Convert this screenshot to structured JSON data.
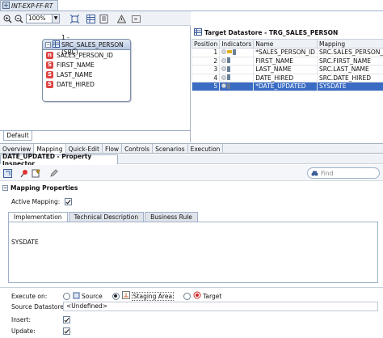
{
  "title_tab": {
    "label": "INT-EXP-FF-RT"
  },
  "diagram": {
    "zoom": "100%",
    "entity": {
      "title": "1 - SRC_SALES_PERSON (SRC)",
      "columns": [
        {
          "icon": "n",
          "name": "SALES_PERSON_ID"
        },
        {
          "icon": "S",
          "name": "FIRST_NAME"
        },
        {
          "icon": "S",
          "name": "LAST_NAME"
        },
        {
          "icon": "S",
          "name": "DATE_HIRED"
        }
      ]
    },
    "default_tab": "Default"
  },
  "target": {
    "title": "Target Datastore - TRG_SALES_PERSON",
    "headers": {
      "position": "Position",
      "indicators": "Indicators",
      "name": "Name",
      "mapping": "Mapping"
    },
    "rows": [
      {
        "position": "1",
        "name": "*SALES_PERSON_ID",
        "mapping": "SRC.SALES_PERSON_ID"
      },
      {
        "position": "2",
        "name": "FIRST_NAME",
        "mapping": "SRC.FIRST_NAME"
      },
      {
        "position": "3",
        "name": "LAST_NAME",
        "mapping": "SRC.LAST_NAME"
      },
      {
        "position": "4",
        "name": "DATE_HIRED",
        "mapping": "SRC.DATE_HIRED"
      },
      {
        "position": "5",
        "name": "*DATE_UPDATED",
        "mapping": "SYSDATE"
      }
    ]
  },
  "tabs": [
    "Overview",
    "Mapping",
    "Quick-Edit",
    "Flow",
    "Controls",
    "Scenarios",
    "Execution"
  ],
  "property_inspector": {
    "title": "DATE_UPDATED - Property Inspector",
    "find_placeholder": "Find",
    "section": "Mapping Properties",
    "active_mapping_label": "Active Mapping:",
    "sub_tabs": [
      "Implementation",
      "Technical Description",
      "Business Rule"
    ],
    "expression": "SYSDATE",
    "execute_on_label": "Execute on:",
    "execute_options": {
      "source": "Source",
      "staging": "Staging Area",
      "target": "Target"
    },
    "source_datastore_label": "Source Datastore:",
    "source_datastore_value": "<Undefined>",
    "insert_label": "Insert:",
    "update_label": "Update:"
  },
  "colors": {
    "selection": "#3a6cc4",
    "accent": "#9fb0c8"
  }
}
